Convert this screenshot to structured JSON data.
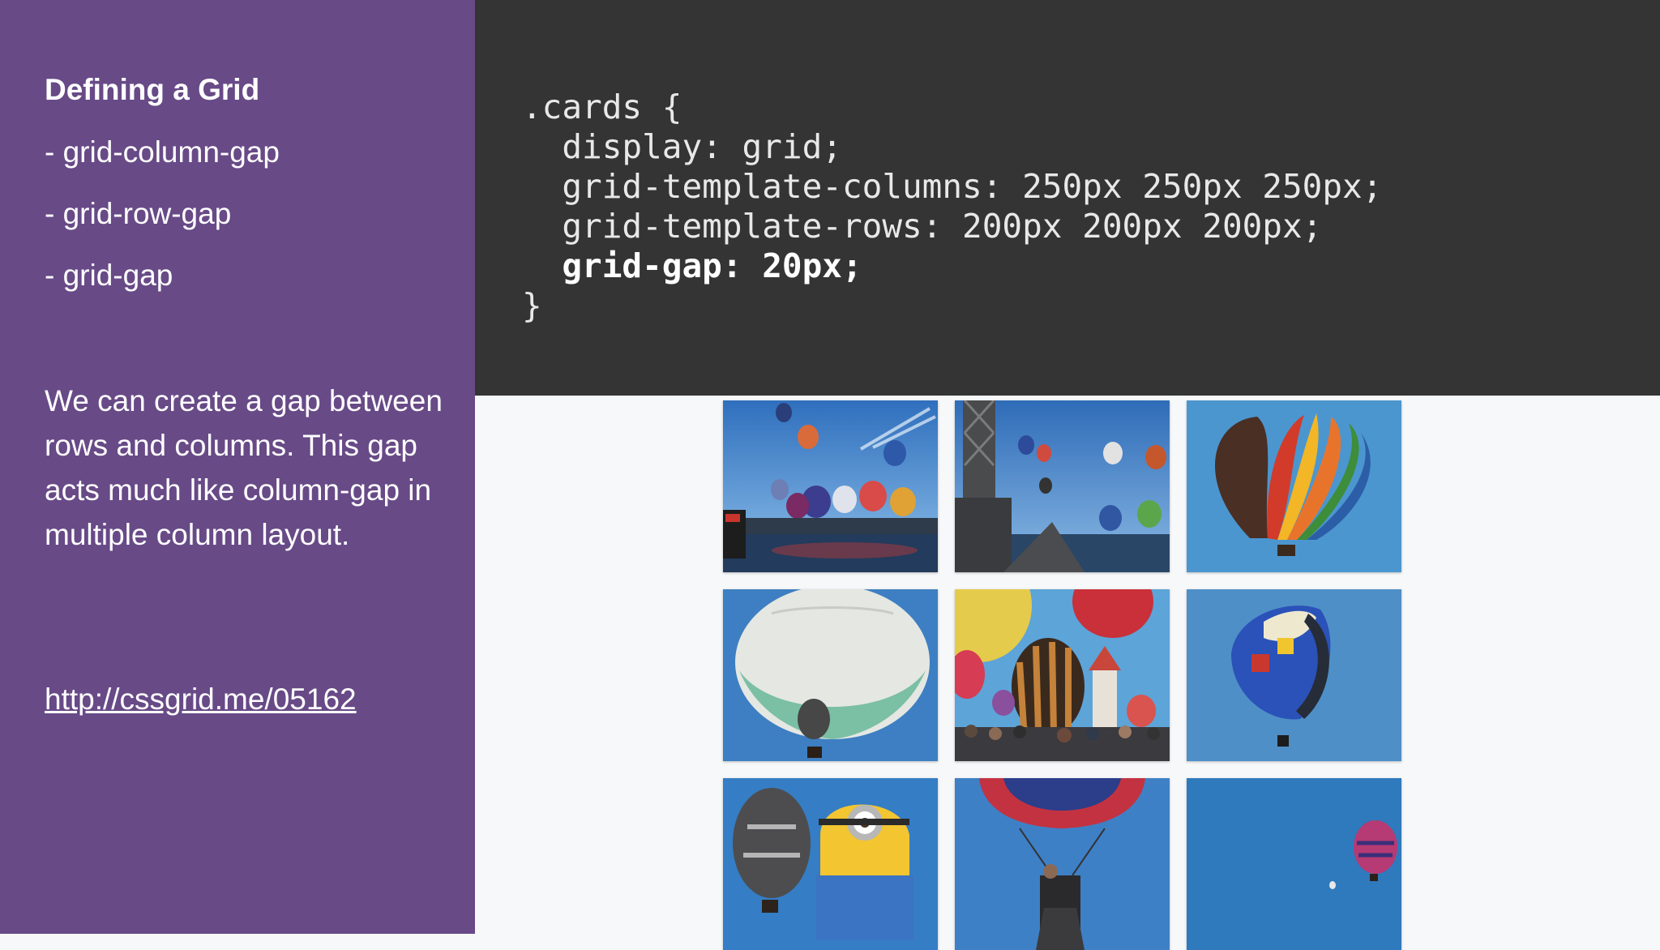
{
  "sidebar": {
    "title": "Defining a Grid",
    "items": [
      {
        "label": "- grid-column-gap"
      },
      {
        "label": "- grid-row-gap"
      },
      {
        "label": "- grid-gap"
      }
    ],
    "description": "We can create a gap between rows and columns. This gap acts much like column-gap in multiple column layout.",
    "link": "http://cssgrid.me/05162"
  },
  "code": {
    "lines": [
      ".cards {",
      "  display: grid;",
      "  grid-template-columns: 250px 250px 250px;",
      "  grid-template-rows: 200px 200px 200px;",
      "  grid-gap: 20px;",
      "}"
    ]
  },
  "gallery": {
    "photos": [
      {
        "name": "balloons-over-harbour-photo"
      },
      {
        "name": "crane-and-balloons-photo"
      },
      {
        "name": "rainbow-balloon-photo"
      },
      {
        "name": "white-balloon-photo"
      },
      {
        "name": "crowd-and-balloons-photo"
      },
      {
        "name": "blue-special-shape-balloon-photo"
      },
      {
        "name": "minion-balloon-photo"
      },
      {
        "name": "balloon-basket-underside-photo"
      },
      {
        "name": "distant-pink-balloon-photo"
      }
    ]
  },
  "colors": {
    "sidebar_bg": "#684a87",
    "code_bg": "#333433",
    "page_bg": "#f7f8fa"
  }
}
